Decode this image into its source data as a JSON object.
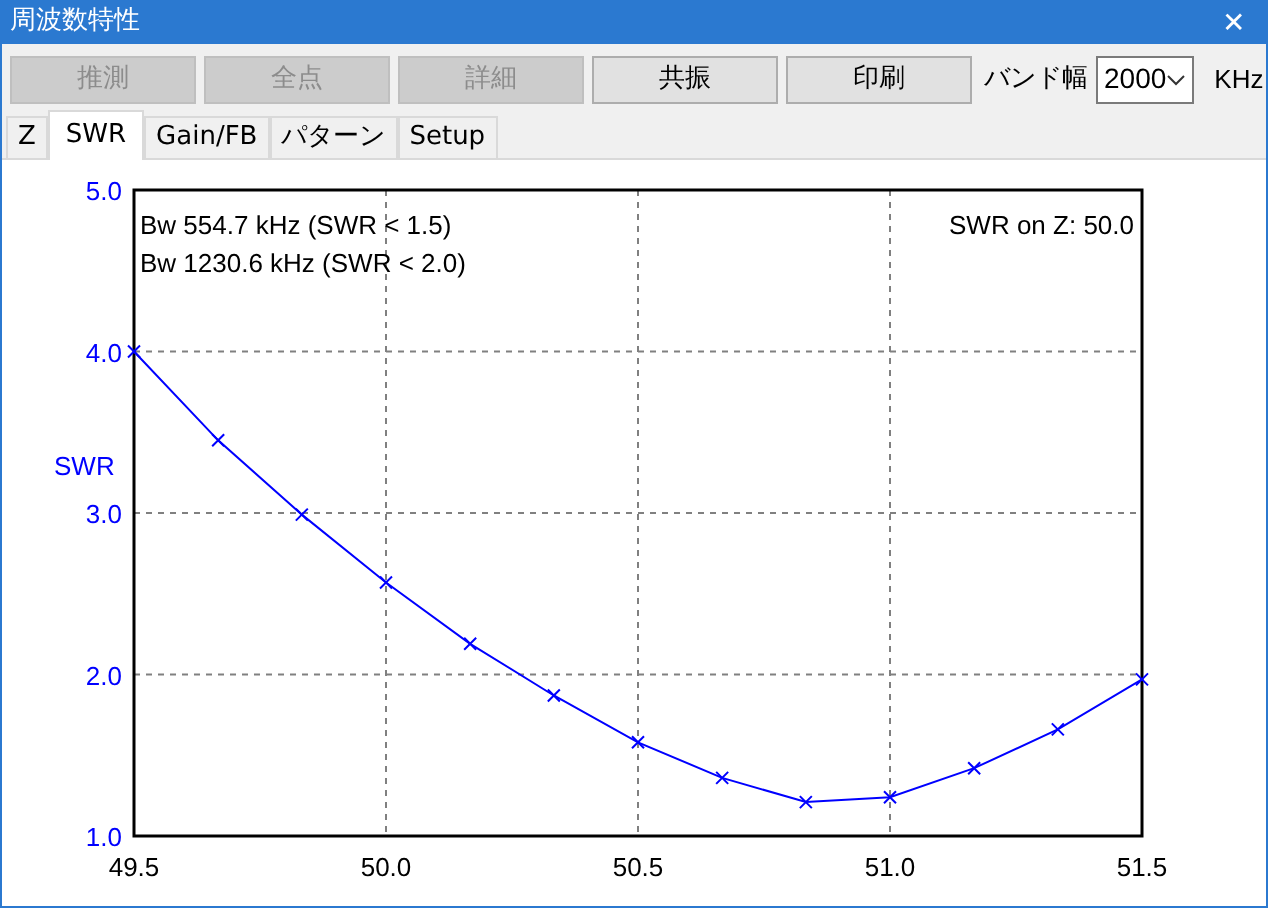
{
  "window": {
    "title": "周波数特性",
    "close": "✕"
  },
  "toolbar": {
    "buttons": [
      {
        "label": "推測",
        "disabled": true
      },
      {
        "label": "全点",
        "disabled": true
      },
      {
        "label": "詳細",
        "disabled": true
      },
      {
        "label": "共振",
        "disabled": false
      },
      {
        "label": "印刷",
        "disabled": false
      }
    ],
    "bandwidth": {
      "label": "バンド幅",
      "value": "2000",
      "unit": "KHz"
    }
  },
  "tabs": [
    {
      "label": "Z",
      "selected": false
    },
    {
      "label": "SWR",
      "selected": true
    },
    {
      "label": "Gain/FB",
      "selected": false
    },
    {
      "label": "パターン",
      "selected": false
    },
    {
      "label": "Setup",
      "selected": false
    }
  ],
  "chart_data": {
    "type": "line",
    "ylabel": "SWR",
    "x": [
      49.5,
      49.667,
      49.833,
      50.0,
      50.167,
      50.333,
      50.5,
      50.667,
      50.833,
      51.0,
      51.167,
      51.333,
      51.5
    ],
    "grid": true,
    "series": [
      {
        "color": "#0000ff",
        "marker": "x",
        "values": [
          4.0,
          3.45,
          2.99,
          2.57,
          2.19,
          1.87,
          1.58,
          1.36,
          1.21,
          1.24,
          1.42,
          1.66,
          1.97
        ]
      }
    ],
    "xlim": [
      49.5,
      51.5
    ],
    "ylim": [
      1,
      5
    ],
    "xticks": [
      {
        "value": 49.5,
        "label": "49.5"
      },
      {
        "value": 50,
        "label": "50.0"
      },
      {
        "value": 50.5,
        "label": "50.5"
      },
      {
        "value": 51,
        "label": "51.0"
      },
      {
        "value": 51.5,
        "label": "51.5"
      }
    ],
    "yticks": [
      {
        "value": 1,
        "label": "1.0"
      },
      {
        "value": 2,
        "label": "2.0"
      },
      {
        "value": 3,
        "label": "3.0"
      },
      {
        "value": 4,
        "label": "4.0"
      },
      {
        "value": 5,
        "label": "5.0"
      }
    ],
    "annotations": [
      "Bw 554.7 kHz (SWR < 1.5)",
      "Bw 1230.6 kHz (SWR < 2.0)",
      "SWR on Z: 50.0"
    ]
  }
}
